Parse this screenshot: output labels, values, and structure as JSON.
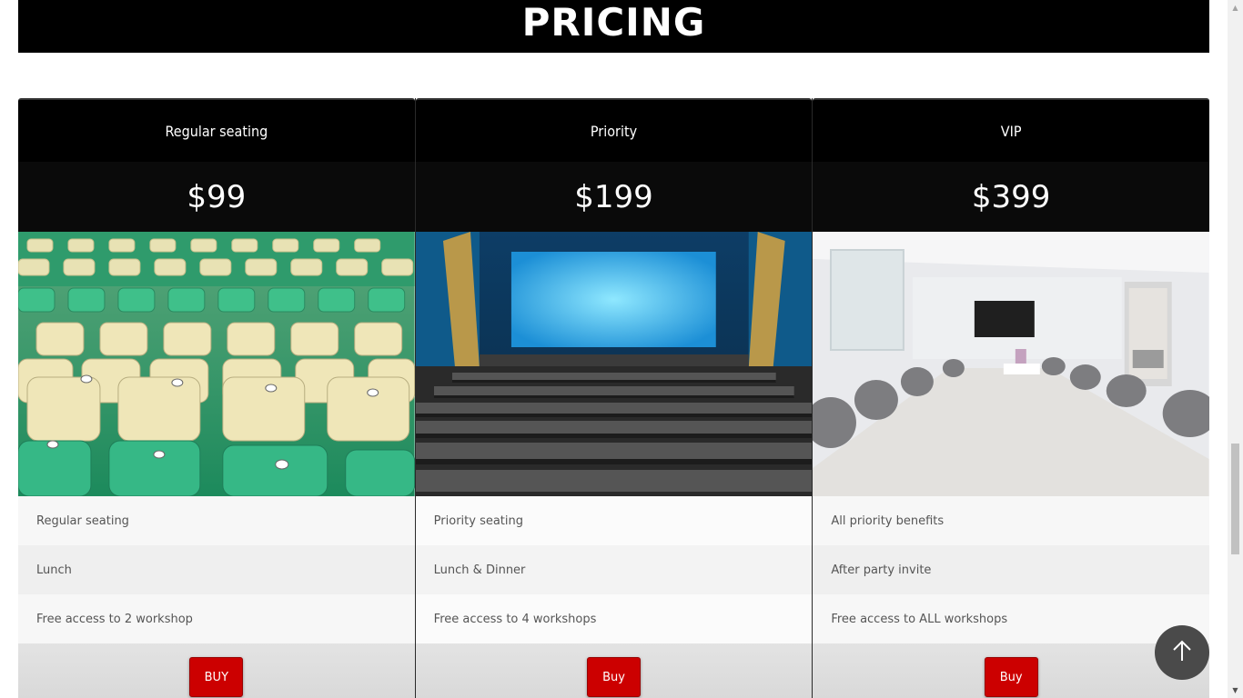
{
  "section": {
    "heading": "PRICING"
  },
  "plans": [
    {
      "title": "Regular seating",
      "price": "$99",
      "image_icon": "stadium-seats-image",
      "features": [
        "Regular seating",
        "Lunch",
        "Free access to 2 workshop"
      ],
      "buy_label": "BUY"
    },
    {
      "title": "Priority",
      "price": "$199",
      "image_icon": "cinema-hall-image",
      "features": [
        "Priority seating",
        "Lunch & Dinner",
        "Free access to 4 workshops"
      ],
      "buy_label": "Buy"
    },
    {
      "title": "VIP",
      "price": "$399",
      "image_icon": "conference-room-image",
      "features": [
        "All priority benefits",
        "After party invite",
        "Free access to ALL workshops"
      ],
      "buy_label": "Buy"
    }
  ],
  "colors": {
    "header_bg": "#000000",
    "buy_button": "#cc0000",
    "back_to_top": "#4a4a4a"
  },
  "back_to_top_icon": "arrow-up-icon"
}
